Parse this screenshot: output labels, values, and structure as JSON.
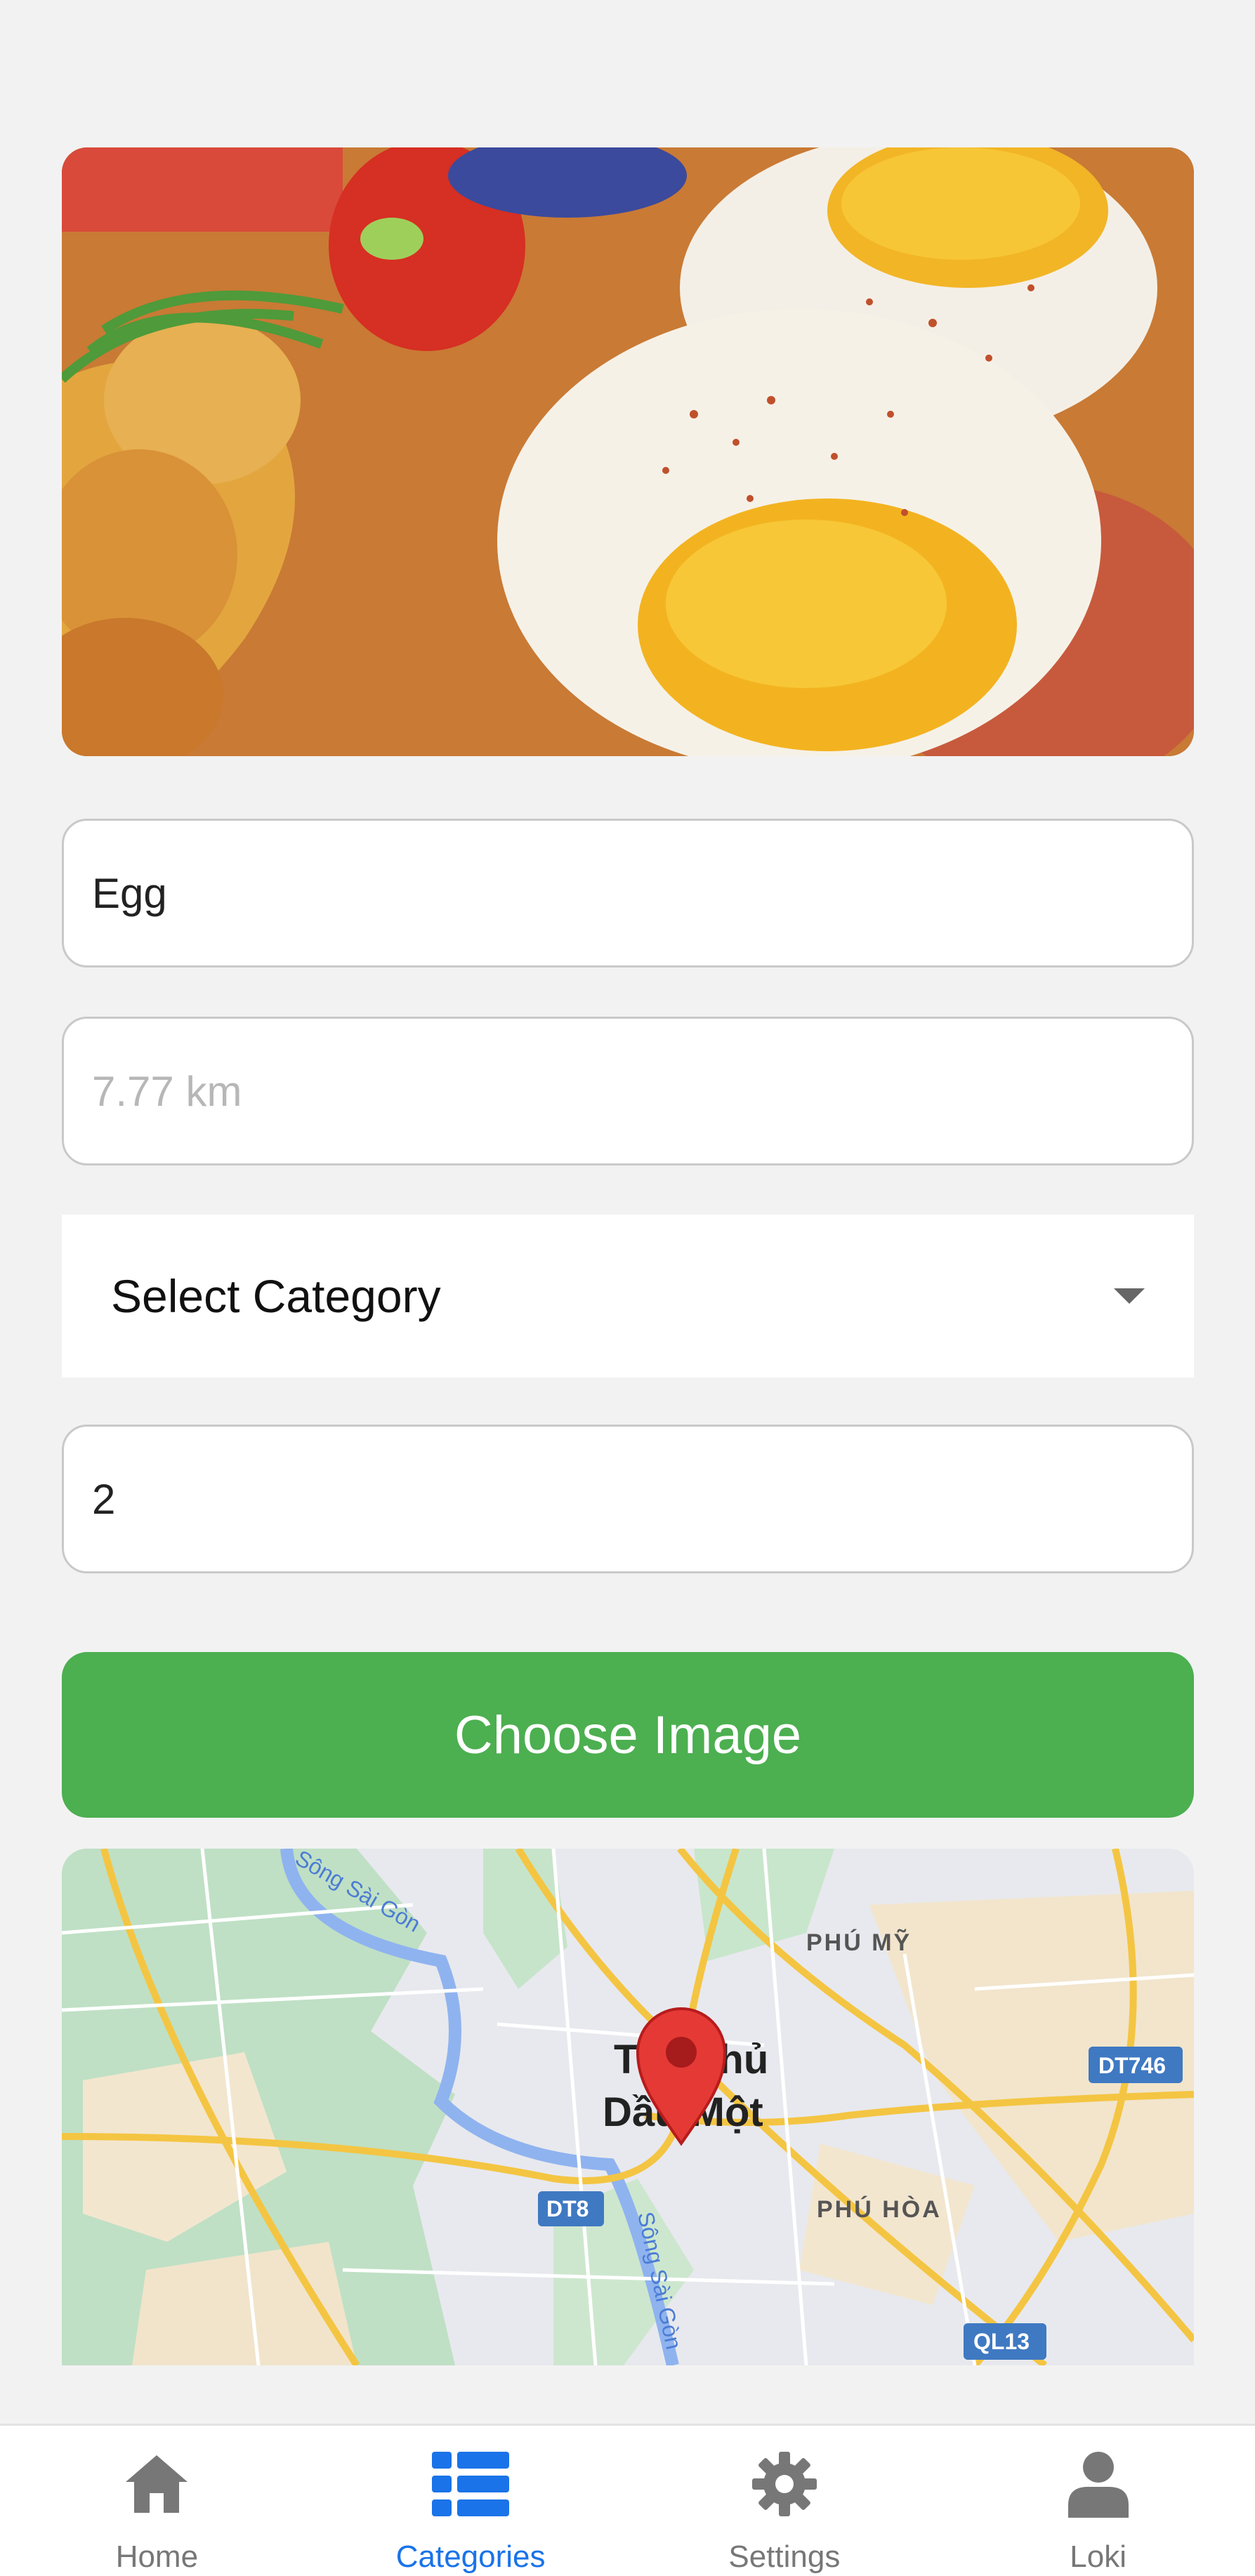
{
  "form": {
    "name_value": "Egg",
    "distance_placeholder": "7.77 km",
    "category_label": "Select Category",
    "quantity_value": "2",
    "choose_image_label": "Choose Image"
  },
  "map": {
    "city_label_line1": "Thủ",
    "city_label_line2": "Dầu Một",
    "prefix_t": "T",
    "area_phu_my": "PHÚ MỸ",
    "area_phu_hoa": "PHÚ HÒA",
    "river_1": "Sông Sài Gòn",
    "river_2": "Sông Sài Gòn",
    "road_dt746": "DT746",
    "road_dt8": "DT8",
    "road_ql13": "QL13"
  },
  "nav": {
    "items": [
      {
        "label": "Home",
        "icon": "home-icon"
      },
      {
        "label": "Categories",
        "icon": "list-icon"
      },
      {
        "label": "Settings",
        "icon": "gear-icon"
      },
      {
        "label": "Loki",
        "icon": "user-icon"
      }
    ],
    "active_index": 1
  },
  "colors": {
    "accent": "#1a73e8",
    "button_green": "#4caf50",
    "nav_inactive": "#777777",
    "marker_red": "#e53935"
  }
}
